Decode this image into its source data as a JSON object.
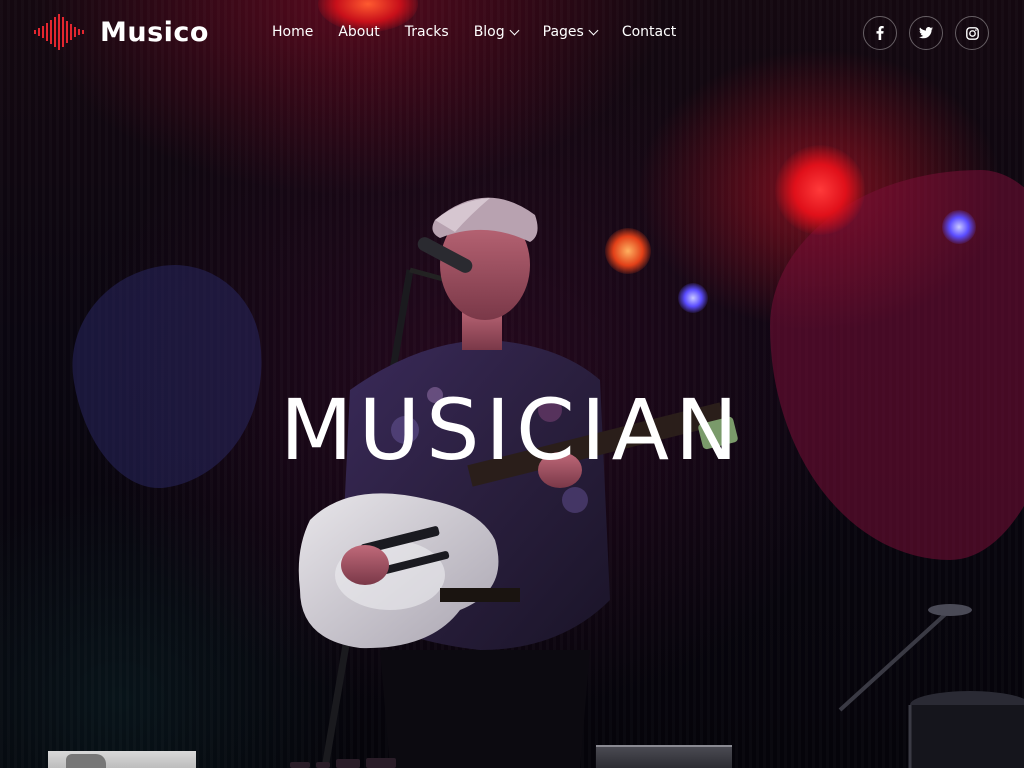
{
  "brand": {
    "name": "Musico",
    "accent_color": "#e3262f"
  },
  "nav": {
    "items": [
      {
        "label": "Home",
        "has_dropdown": false
      },
      {
        "label": "About",
        "has_dropdown": false
      },
      {
        "label": "Tracks",
        "has_dropdown": false
      },
      {
        "label": "Blog",
        "has_dropdown": true
      },
      {
        "label": "Pages",
        "has_dropdown": true
      },
      {
        "label": "Contact",
        "has_dropdown": false
      }
    ]
  },
  "social": [
    {
      "icon": "facebook-icon"
    },
    {
      "icon": "twitter-icon"
    },
    {
      "icon": "instagram-icon"
    }
  ],
  "hero": {
    "title": "MUSICIAN"
  }
}
